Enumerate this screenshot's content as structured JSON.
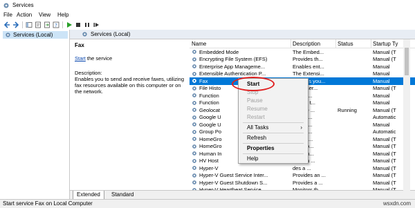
{
  "window": {
    "title": "Services"
  },
  "menubar": {
    "items": [
      "File",
      "Action",
      "View",
      "Help"
    ]
  },
  "toolbar": {
    "icons": [
      "back-arrow",
      "forward-arrow",
      "console-tree",
      "properties",
      "export",
      "help",
      "play",
      "stop",
      "pause",
      "restart"
    ]
  },
  "left": {
    "node_label": "Services (Local)"
  },
  "right": {
    "header": "Services (Local)",
    "detail": {
      "service_name": "Fax",
      "start_link": "Start",
      "start_suffix": " the service",
      "description_label": "Description:",
      "description_text": "Enables you to send and receive faxes, utilizing fax resources available on this computer or on the network."
    },
    "columns": [
      "Name",
      "Description",
      "Status",
      "Startup Ty"
    ],
    "rows": [
      {
        "name": "Embedded Mode",
        "desc": "The Embed...",
        "status": "",
        "startup": "Manual (T"
      },
      {
        "name": "Encrypting File System (EFS)",
        "desc": "Provides th...",
        "status": "",
        "startup": "Manual (T"
      },
      {
        "name": "Enterprise App Manageme...",
        "desc": "Enables ent...",
        "status": "",
        "startup": "Manual"
      },
      {
        "name": "Extensible Authentication P...",
        "desc": "The Extensi...",
        "status": "",
        "startup": "Manual"
      },
      {
        "name": "Fax",
        "desc": "Enables you...",
        "status": "",
        "startup": "Manual"
      },
      {
        "name": "File Histo",
        "desc": "ects user...",
        "status": "",
        "startup": "Manual (T"
      },
      {
        "name": "Function",
        "desc": "OPHO...",
        "status": "",
        "startup": "Manual"
      },
      {
        "name": "Function",
        "desc": "ISHES t...",
        "status": "",
        "startup": "Manual"
      },
      {
        "name": "Geolocat",
        "desc": "service ...",
        "status": "Running",
        "startup": "Manual (T"
      },
      {
        "name": "Google U",
        "desc": "s your ...",
        "status": "",
        "startup": "Automatic"
      },
      {
        "name": "Google U",
        "desc": "s your ...",
        "status": "",
        "startup": "Manual"
      },
      {
        "name": "Group Po",
        "desc": "ervice ...",
        "status": "",
        "startup": "Automatic"
      },
      {
        "name": "HomeGro",
        "desc": "rms ne...",
        "status": "",
        "startup": "Manual (T"
      },
      {
        "name": "HomeGro",
        "desc": "s the lo...",
        "status": "",
        "startup": "Manual (T"
      },
      {
        "name": "Human In",
        "desc": "ates an...",
        "status": "",
        "startup": "Manual (T"
      },
      {
        "name": "HV Host",
        "desc": "ides an ...",
        "status": "",
        "startup": "Manual (T"
      },
      {
        "name": "Hyper-V",
        "desc": "des a ...",
        "status": "",
        "startup": "Manual (T"
      },
      {
        "name": "Hyper-V Guest Service Inter...",
        "desc": "Provides an ...",
        "status": "",
        "startup": "Manual (T"
      },
      {
        "name": "Hyper-V Guest Shutdown S...",
        "desc": "Provides a ...",
        "status": "",
        "startup": "Manual (T"
      },
      {
        "name": "Hyper-V Heartbeat Service",
        "desc": "Monitors th...",
        "status": "",
        "startup": "Manual (T"
      }
    ],
    "tabs": [
      "Extended",
      "Standard"
    ]
  },
  "context_menu": {
    "items": [
      {
        "label": "Start",
        "state": "bold-circled"
      },
      {
        "label": "Stop",
        "state": "disabled"
      },
      {
        "label": "Pause",
        "state": "disabled"
      },
      {
        "label": "Resume",
        "state": "disabled"
      },
      {
        "label": "Restart",
        "state": "disabled"
      },
      {
        "label": "All Tasks",
        "state": "submenu"
      },
      {
        "label": "Refresh",
        "state": "normal"
      },
      {
        "label": "Properties",
        "state": "bold"
      },
      {
        "label": "Help",
        "state": "normal"
      }
    ]
  },
  "status": {
    "text": "Start service Fax on Local Computer"
  },
  "watermark": "wsxdn.com",
  "colors": {
    "selection": "#0078d7",
    "circle": "#e02020",
    "header_bg": "#e8edf4"
  }
}
